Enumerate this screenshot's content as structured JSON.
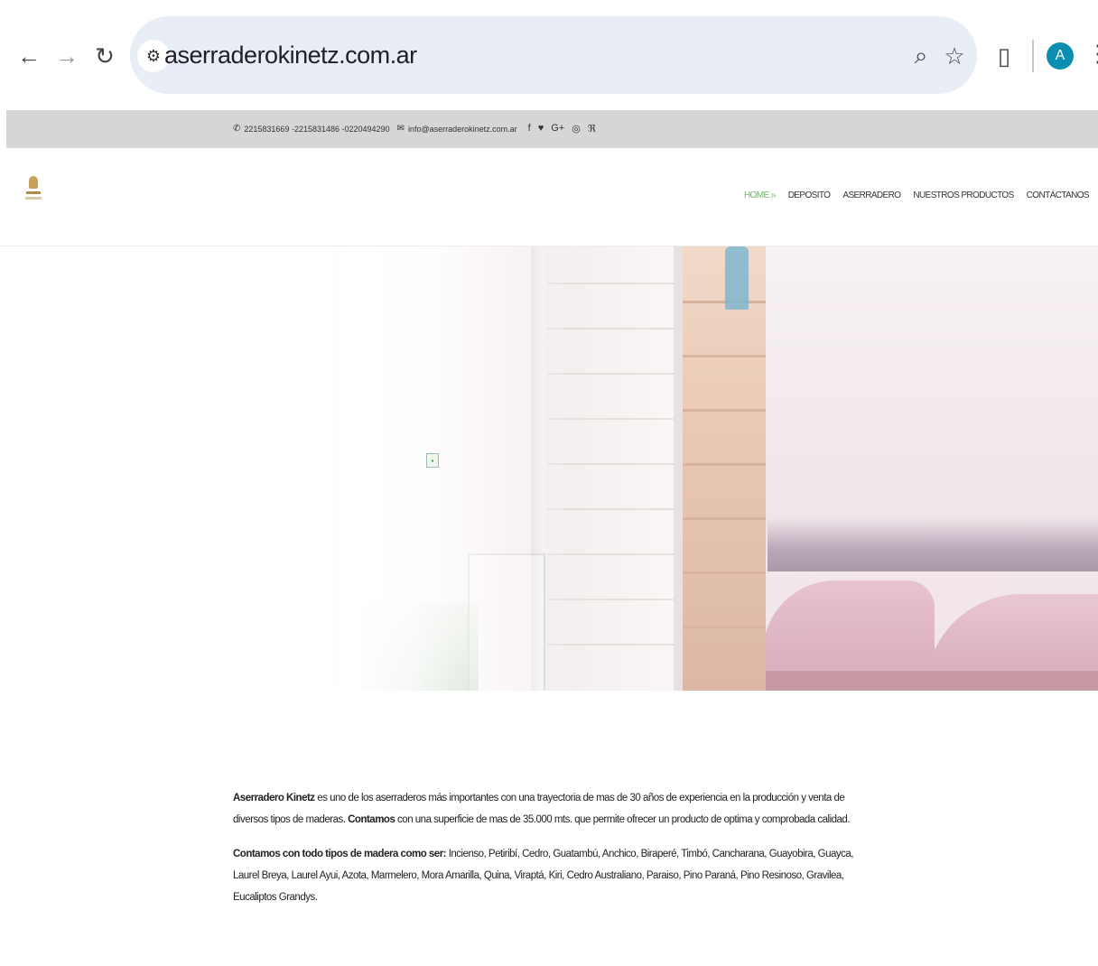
{
  "browser": {
    "url": "aserraderokinetz.com.ar",
    "profile_initial": "A",
    "icons": {
      "back": "back-arrow-icon",
      "forward": "forward-arrow-icon",
      "reload": "reload-icon",
      "site_info": "tune-icon",
      "zoom": "zoom-icon",
      "bookmark": "star-icon",
      "extensions": "puzzle-icon",
      "menu": "more-vert-icon"
    }
  },
  "topbar": {
    "phones": "2215831669 -2215831486 -0220494290",
    "email": "info@aserraderokinetz.com.ar"
  },
  "nav": {
    "items": [
      "HOME »",
      "DEPOSITO",
      "ASERRADERO",
      "NUESTROS PRODUCTOS",
      "CONTÁCTANOS"
    ]
  },
  "content": {
    "p1_bold1": "Aserradero Kinetz",
    "p1_text1": " es uno de los aserraderos más importantes con una trayectoria de mas de 30 años de experiencia en la producción y venta de diversos tipos de maderas. ",
    "p1_bold2": "Contamos",
    "p1_text2": " con una superficie de mas de 35.000 mts. que permite ofrecer un producto de optima y comprobada calidad.",
    "p2_bold": "Contamos con todo tipos de madera como ser:",
    "p2_text": " Incienso, Petiribí, Cedro, Guatambú, Anchico, Biraperé, Timbó, Cancharana, Guayobira, Guayca, Laurel Breya, Laurel Ayui, Azota, Marmelero, Mora Amarilla, Quina, Viraptá, Kiri, Cedro Australiano, Paraiso, Pino Paraná, Pino Resinoso, Gravilea, Eucaliptos Grandys."
  },
  "colors": {
    "nav_active": "#6fb36f",
    "topbar_bg": "#d6d6d6",
    "omnibox_bg": "#e9edf6",
    "avatar_bg": "#0b8fb0"
  }
}
